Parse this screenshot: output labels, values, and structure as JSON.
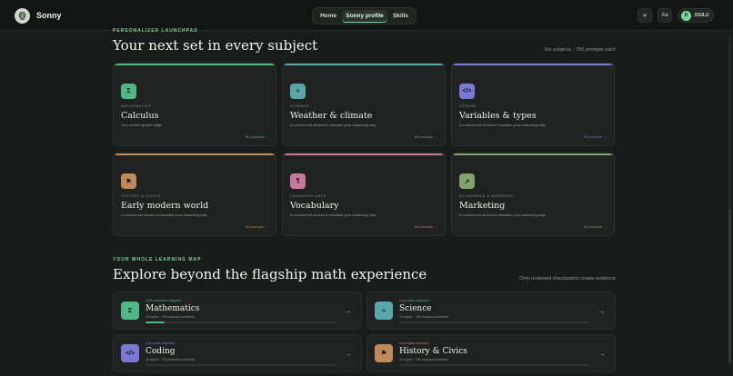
{
  "app": {
    "brand": "Sonny"
  },
  "nav": {
    "tabs": [
      "Home",
      "Sonny profile",
      "Skills"
    ],
    "active_tab": "Sonny profile"
  },
  "header_actions": {
    "theme_icon": "sun-icon",
    "text_button": "Aa",
    "user_initial": "D",
    "user_name": "DGILU"
  },
  "launchpad": {
    "eyebrow": "PERSONALIZED LAUNCHPAD",
    "title": "Your next set in every subject",
    "meta": "Six subjects · 750 prompts each",
    "cards": [
      {
        "category": "MATHEMATICS",
        "title": "Calculus",
        "desc": "Your current growth edge",
        "count": "50 prompts →",
        "color": "#4fb788",
        "icon_text": "Σ"
      },
      {
        "category": "SCIENCE",
        "title": "Weather & climate",
        "desc": "A connect set chosen to broaden your reasoning map",
        "count": "50 prompts →",
        "color": "#58a7a8",
        "icon_text": "≈"
      },
      {
        "category": "CODING",
        "title": "Variables & types",
        "desc": "A connect set chosen to broaden your reasoning map",
        "count": "50 prompts →",
        "color": "#7b79d6",
        "icon_text": "</>"
      },
      {
        "category": "HISTORY & CIVICS",
        "title": "Early modern world",
        "desc": "A connect set chosen to broaden your reasoning map",
        "count": "50 prompts →",
        "color": "#c08a5c",
        "icon_text": "⚑"
      },
      {
        "category": "LANGUAGE ARTS",
        "title": "Vocabulary",
        "desc": "A connect set chosen to broaden your reasoning map",
        "count": "50 prompts →",
        "color": "#c8789b",
        "icon_text": "¶"
      },
      {
        "category": "ECONOMICS & BUSINESS",
        "title": "Marketing",
        "desc": "A connect set chosen to broaden your reasoning map",
        "count": "50 prompts →",
        "color": "#7fa36d",
        "icon_text": "↗"
      }
    ]
  },
  "learning_map": {
    "eyebrow": "YOUR WHOLE LEARNING MAP",
    "title": "Explore beyond the flagship math experience",
    "meta": "Only reviewed checkpoints create evidence",
    "subjects": [
      {
        "small": "10% evidence mapped",
        "title": "Mathematics",
        "sub": "10 topics · 750 compact problems",
        "progress": 0.1,
        "color": "#4fb788",
        "icon_text": "Σ"
      },
      {
        "small": "0 prompts explored",
        "title": "Science",
        "sub": "10 topics · 750 compact problems",
        "progress": 0.0,
        "color": "#58a7a8",
        "icon_text": "≈"
      },
      {
        "small": "0 prompts explored",
        "title": "Coding",
        "sub": "10 topics · 750 compact problems",
        "progress": 0.0,
        "color": "#7b79d6",
        "icon_text": "</>"
      },
      {
        "small": "0 prompts explored",
        "title": "History & Civics",
        "sub": "10 topics · 750 compact problems",
        "progress": 0.0,
        "color": "#c08a5c",
        "icon_text": "⚑"
      }
    ]
  }
}
